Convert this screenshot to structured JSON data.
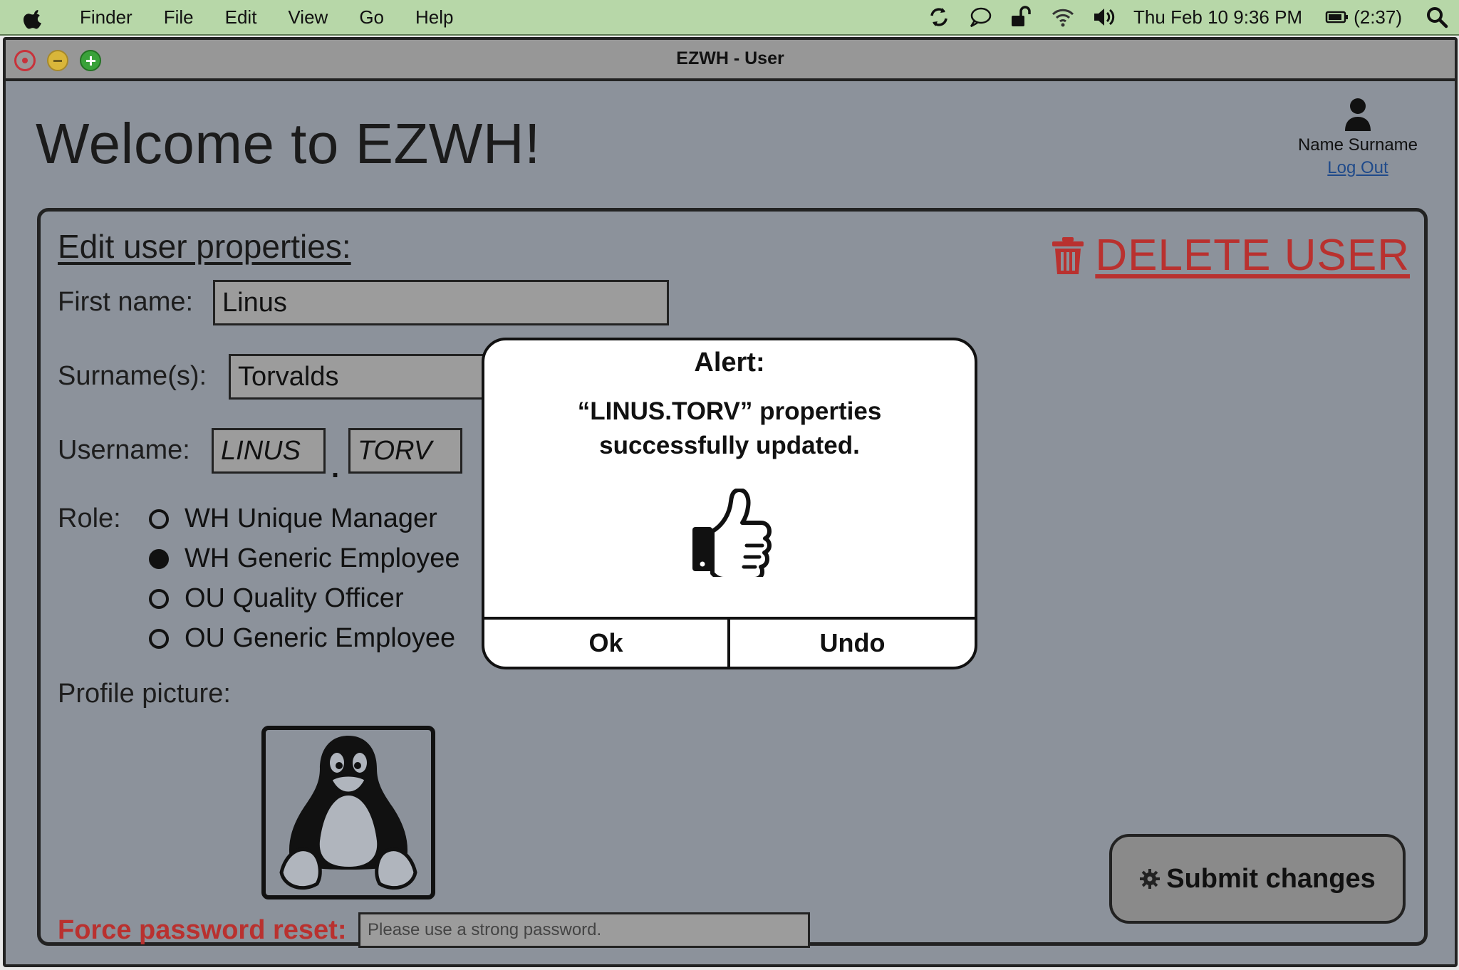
{
  "menubar": {
    "menus": [
      "Finder",
      "File",
      "Edit",
      "View",
      "Go",
      "Help"
    ],
    "datetime": "Thu Feb 10  9:36 PM",
    "battery": "(2:37)",
    "status_icons": [
      "sync-icon",
      "chat-bubble-icon",
      "lock-open-icon",
      "wifi-icon",
      "speaker-icon",
      "battery-icon",
      "search-icon"
    ]
  },
  "window": {
    "title": "EZWH - User"
  },
  "header": {
    "welcome": "Welcome to EZWH!",
    "user_name": "Name Surname",
    "logout_label": "Log Out"
  },
  "panel": {
    "title": "Edit user properties:",
    "delete_label": "DELETE USER",
    "first_name_label": "First name:",
    "first_name_value": "Linus",
    "surname_label": "Surname(s):",
    "surname_value": "Torvalds",
    "username_label": "Username:",
    "username_part1": "LINUS",
    "username_separator": ".",
    "username_part2": "TORV",
    "role_label": "Role:",
    "roles": [
      {
        "label": "WH Unique Manager",
        "selected": false
      },
      {
        "label": "WH Generic Employee",
        "selected": true
      },
      {
        "label": "OU Quality Officer",
        "selected": false
      },
      {
        "label": "OU Generic Employee",
        "selected": false
      }
    ],
    "profile_label": "Profile picture:",
    "force_reset_label": "Force password reset:",
    "password_placeholder": "Please use a strong password.",
    "submit_label": "Submit changes"
  },
  "alert": {
    "title": "Alert:",
    "message": "“LINUS.TORV” properties successfully updated.",
    "ok_label": "Ok",
    "undo_label": "Undo"
  },
  "colors": {
    "menubar_bg": "#b7d7a8",
    "window_bg": "#8c929b",
    "danger": "#b9312f",
    "link": "#1f4a8a"
  }
}
